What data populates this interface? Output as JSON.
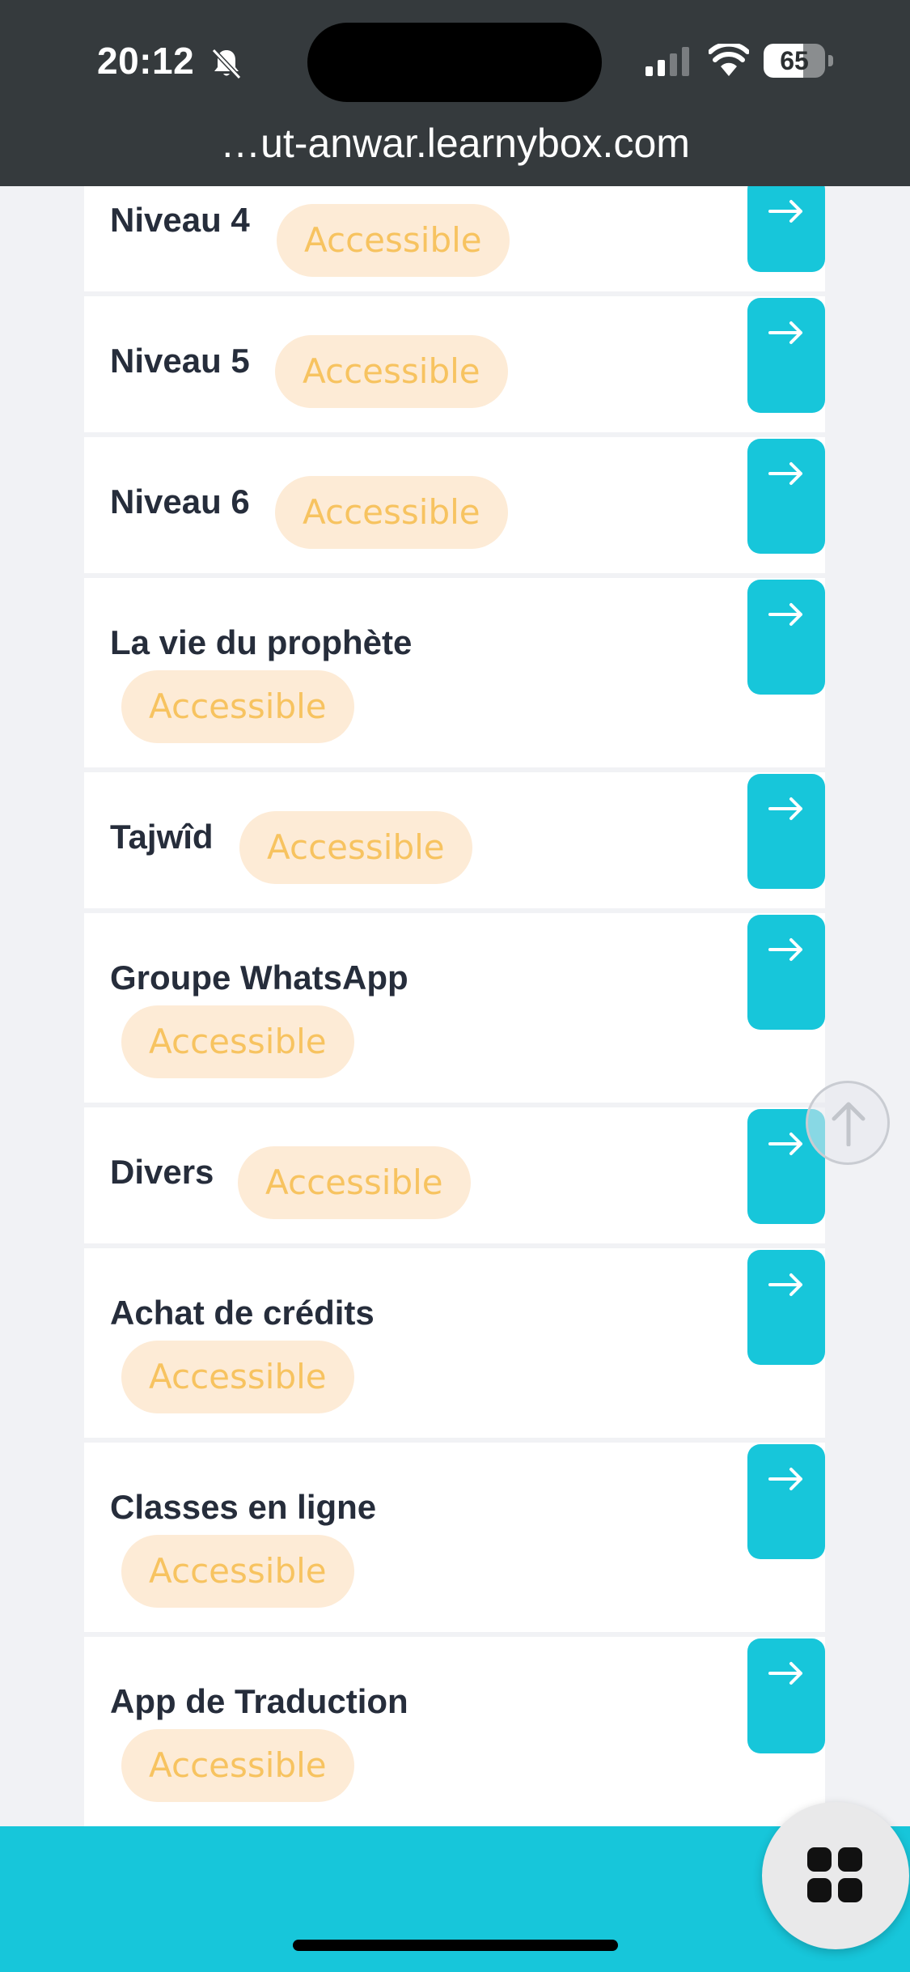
{
  "status_bar": {
    "time": "20:12",
    "battery_level": 65,
    "battery_text": "65",
    "icons": [
      "bell-slash-icon",
      "signal-icon",
      "wifi-icon",
      "battery-icon"
    ]
  },
  "browser": {
    "url": "…ut-anwar.learnybox.com"
  },
  "modules": [
    {
      "title": "Niveau 4",
      "status": "Accessible"
    },
    {
      "title": "Niveau 5",
      "status": "Accessible"
    },
    {
      "title": "Niveau 6",
      "status": "Accessible"
    },
    {
      "title": "La vie du prophète",
      "status": "Accessible"
    },
    {
      "title": "Tajwîd",
      "status": "Accessible"
    },
    {
      "title": "Groupe WhatsApp",
      "status": "Accessible"
    },
    {
      "title": "Divers",
      "status": "Accessible"
    },
    {
      "title": "Achat de crédits",
      "status": "Accessible"
    },
    {
      "title": "Classes en ligne",
      "status": "Accessible"
    },
    {
      "title": "App de Traduction",
      "status": "Accessible"
    }
  ],
  "icons": {
    "module_button": "arrow-right-icon",
    "scroll_top": "arrow-up-icon",
    "apps": "grid-icon"
  },
  "colors": {
    "top_bar": "#353a3d",
    "accent": "#17c6da",
    "badge_bg": "#fdebd6",
    "badge_text": "#f7c360",
    "title_text": "#262d3b",
    "page_bg": "#f1f2f5"
  }
}
